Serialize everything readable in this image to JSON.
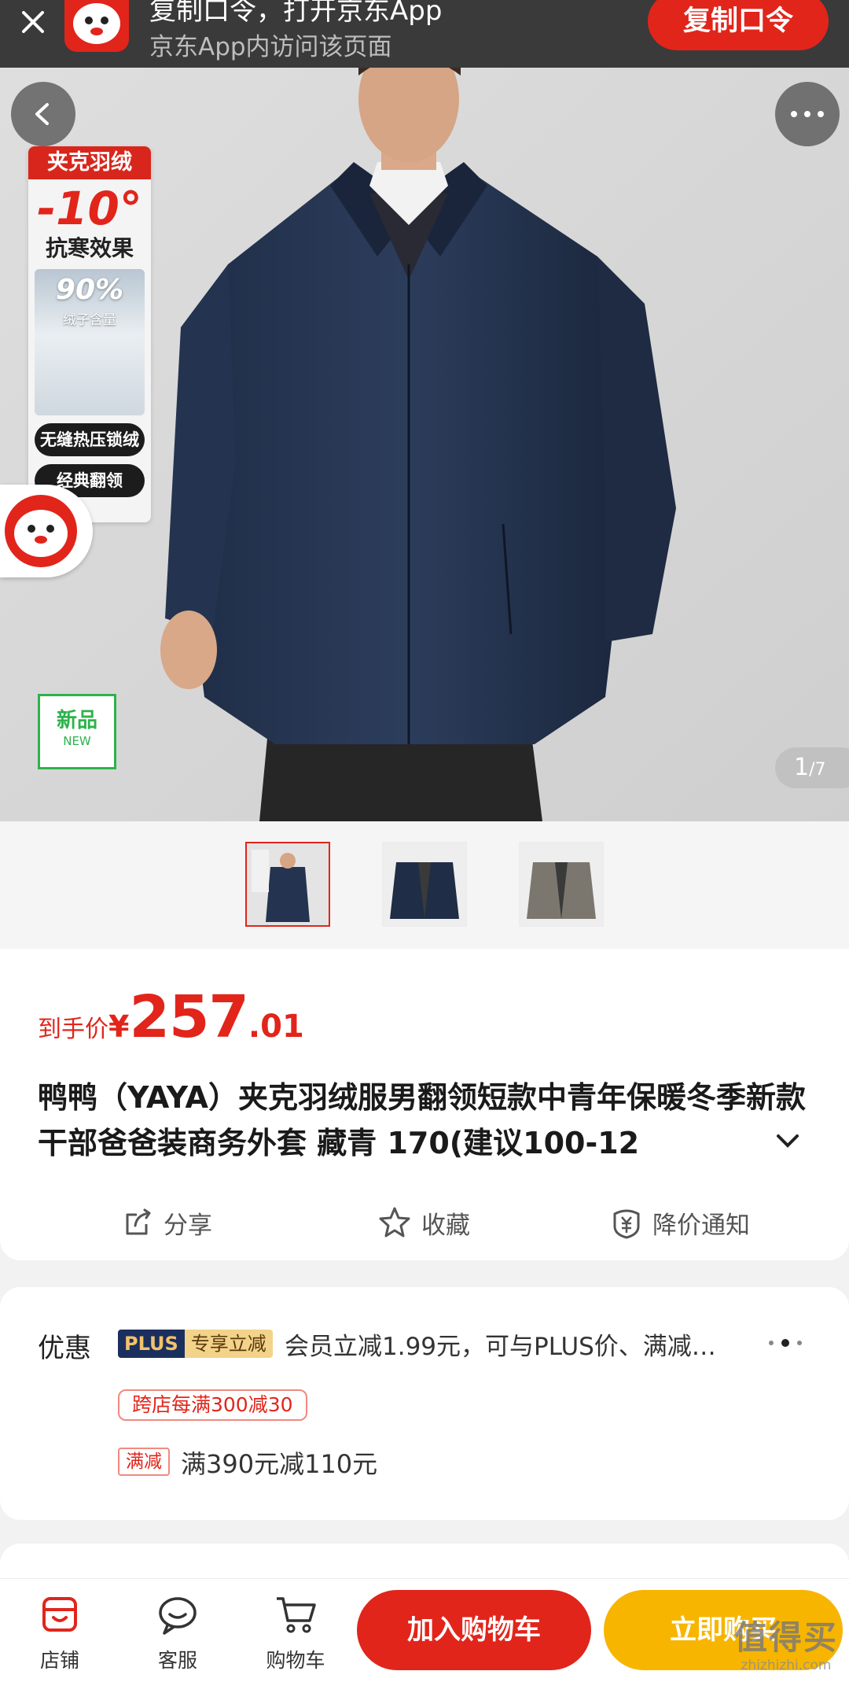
{
  "banner": {
    "title": "复制口令，打开京东App",
    "subtitle": "京东App内访问该页面",
    "copy_button": "复制口令"
  },
  "hero": {
    "promo": {
      "head": "夹克羽绒",
      "temp": "-10°",
      "effect": "抗寒效果",
      "percent": "90%",
      "percent_label": "绒子含量",
      "feature1": "无缝热压锁绒",
      "feature2": "经典翻领"
    },
    "new_badge": {
      "cn": "新品",
      "en": "NEW"
    },
    "counter": {
      "current": "1",
      "total": "/7"
    }
  },
  "thumbnails": {
    "count": 3,
    "active_index": 0
  },
  "product": {
    "price_label": "到手价",
    "currency": "¥",
    "price_int": "257",
    "price_dec": ".01",
    "title": "鸭鸭（YAYA）夹克羽绒服男翻领短款中青年保暖冬季新款干部爸爸装商务外套 藏青 170(建议100-12",
    "actions": {
      "share": "分享",
      "favorite": "收藏",
      "price_alert": "降价通知"
    }
  },
  "offers": {
    "label": "优惠",
    "plus_badge": "PLUS",
    "plus_badge_tag": "专享立减",
    "plus_text": "会员立减1.99元，可与PLUS价、满减…",
    "cross_store_tag": "跨店每满300减30",
    "full_tag": "满减",
    "full_text": "满390元减110元"
  },
  "bottom_bar": {
    "store": "店铺",
    "service": "客服",
    "cart": "购物车",
    "add_to_cart": "加入购物车",
    "buy_now": "立即购买"
  },
  "watermark": {
    "text": "值得买",
    "url": "zhizhizhi.com"
  },
  "colors": {
    "accent": "#e1251b",
    "buy": "#f7b500",
    "banner_bg": "#3a3a3a"
  }
}
